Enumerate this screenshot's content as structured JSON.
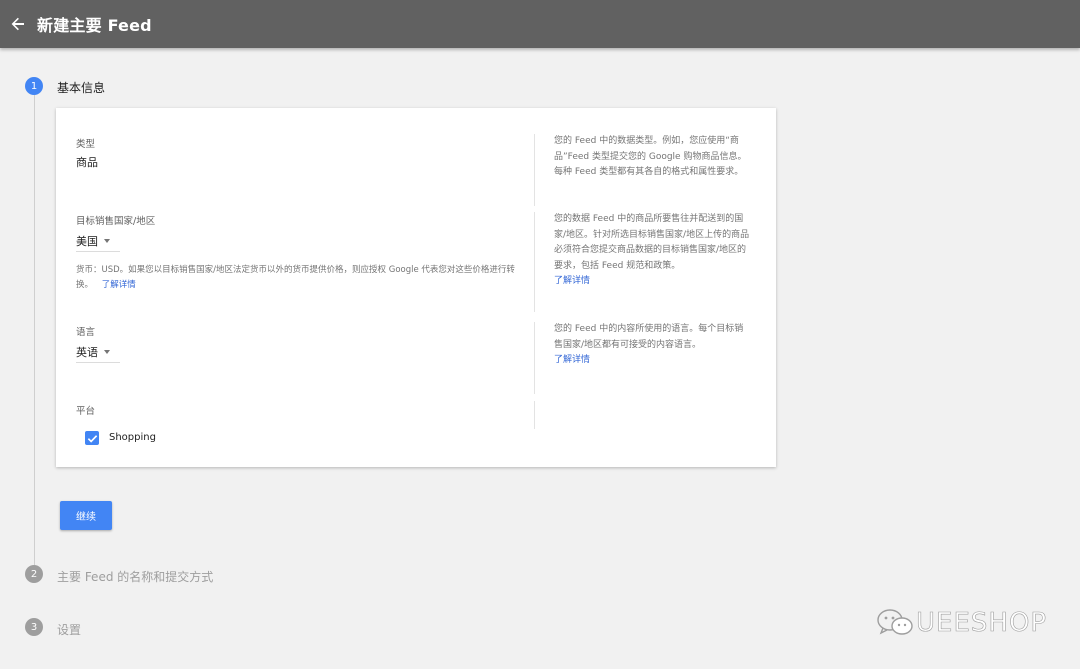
{
  "header": {
    "title": "新建主要 Feed",
    "back_icon": "arrow-back-icon"
  },
  "steps": [
    {
      "number": "1",
      "label": "基本信息",
      "active": true
    },
    {
      "number": "2",
      "label": "主要 Feed 的名称和提交方式",
      "active": false
    },
    {
      "number": "3",
      "label": "设置",
      "active": false
    }
  ],
  "form": {
    "type": {
      "label": "类型",
      "value": "商品",
      "help": "您的 Feed 中的数据类型。例如，您应使用“商品”Feed 类型提交您的 Google 购物商品信息。每种 Feed 类型都有其各自的格式和属性要求。"
    },
    "country": {
      "label": "目标销售国家/地区",
      "value": "美国",
      "note": "货币：USD。如果您以目标销售国家/地区法定货币以外的货币提供价格，则应授权 Google 代表您对这些价格进行转换。",
      "note_link": "了解详情",
      "help": "您的数据 Feed 中的商品所要售往并配送到的国家/地区。针对所选目标销售国家/地区上传的商品必须符合您提交商品数据的目标销售国家/地区的要求，包括 Feed 规范和政策。",
      "help_link": "了解详情"
    },
    "language": {
      "label": "语言",
      "value": "英语",
      "help": "您的 Feed 中的内容所使用的语言。每个目标销售国家/地区都有可接受的内容语言。",
      "help_link": "了解详情"
    },
    "platform": {
      "label": "平台",
      "option_label": "Shopping",
      "checked": true
    }
  },
  "actions": {
    "continue_label": "继续"
  },
  "watermark": {
    "text": "UEESHOP"
  },
  "colors": {
    "accent": "#4285f4",
    "topbar": "#616161",
    "link": "#3367d6",
    "step_inactive": "#9e9e9e"
  }
}
